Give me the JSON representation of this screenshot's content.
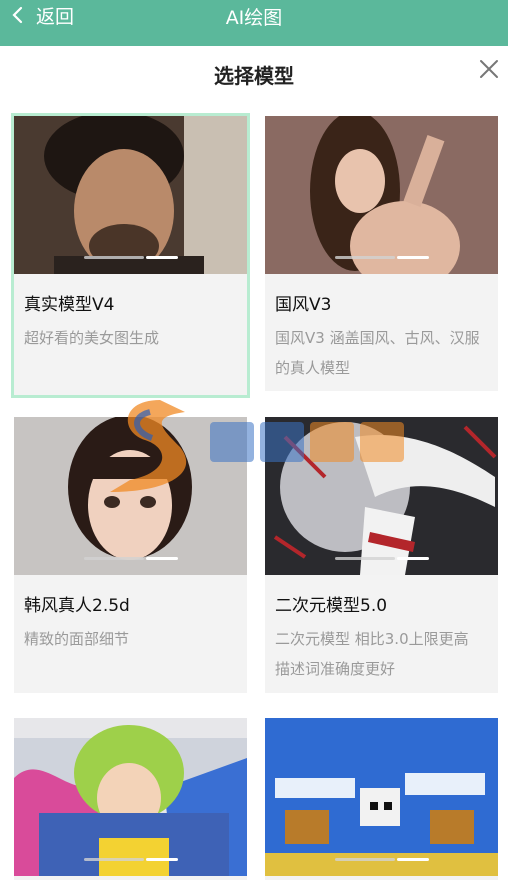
{
  "topbar": {
    "back_label": "返回",
    "title": "AI绘图"
  },
  "sheet": {
    "title": "选择模型"
  },
  "models": [
    {
      "name": "真实模型V4",
      "desc": "超好看的美女图生成"
    },
    {
      "name": "国风V3",
      "desc": "国风V3 涵盖国风、古风、汉服的真人模型"
    },
    {
      "name": "韩风真人2.5d",
      "desc": "精致的面部细节"
    },
    {
      "name": "二次元模型5.0",
      "desc": "二次元模型 相比3.0上限更高 描述词准确度更好"
    },
    {
      "name": "",
      "desc": ""
    },
    {
      "name": "",
      "desc": ""
    }
  ],
  "colors": {
    "header": "#5bb89b",
    "selected_border": "#b8ecd1"
  }
}
